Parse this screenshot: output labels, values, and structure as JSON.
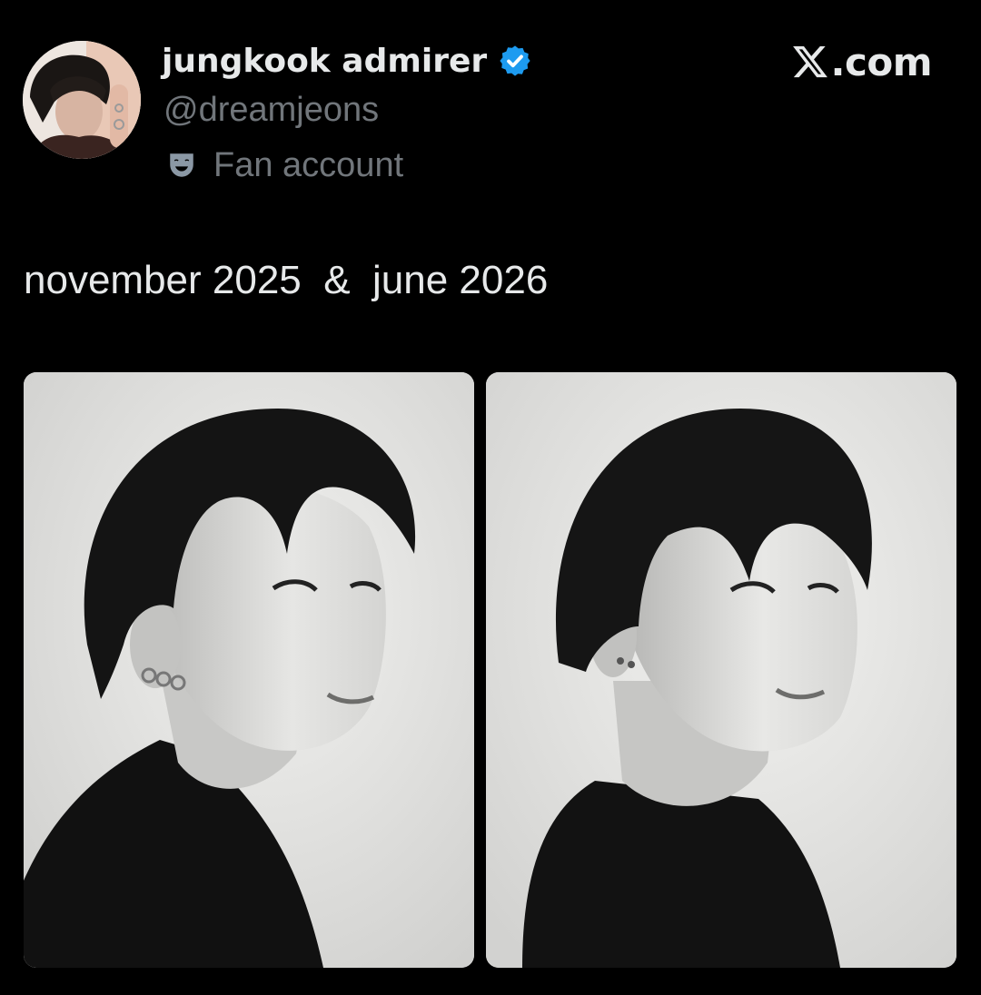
{
  "post": {
    "author": {
      "display_name": "jungkook admirer",
      "handle": "@dreamjeons",
      "label": "Fan account",
      "verified": true,
      "avatar_icon": "avatar-portrait"
    },
    "source": {
      "logo_icon": "x-logo-icon",
      "suffix": ".com"
    },
    "text": "november 2025  &  june 2026",
    "media": [
      {
        "kind": "photo",
        "description_icon": "portrait-photo-icon"
      },
      {
        "kind": "photo",
        "description_icon": "portrait-photo-icon"
      }
    ]
  },
  "colors": {
    "background": "#000000",
    "primary_text": "#e7e9ea",
    "secondary_text": "#71767b",
    "verified_blue": "#1d9bf0"
  }
}
